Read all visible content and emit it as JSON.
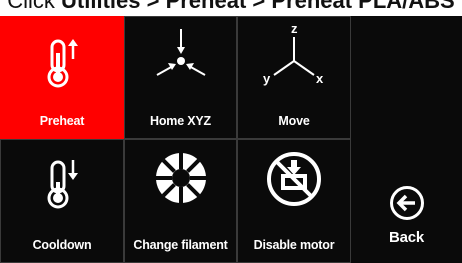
{
  "instruction": {
    "prefix": "Click ",
    "path": "Utilities > Preheat > Preheat PLA/ABS"
  },
  "menu": {
    "tiles": [
      {
        "label": "Preheat",
        "icon": "thermometer-up-icon",
        "active": true
      },
      {
        "label": "Home XYZ",
        "icon": "home-xyz-icon"
      },
      {
        "label": "Move",
        "icon": "axes-icon"
      },
      {
        "label": "Cooldown",
        "icon": "thermometer-down-icon"
      },
      {
        "label": "Change filament",
        "icon": "filament-spool-icon"
      },
      {
        "label": "Disable motor",
        "icon": "disable-motor-icon"
      }
    ],
    "back": {
      "label": "Back",
      "icon": "back-arrow-icon"
    }
  },
  "colors": {
    "active": "#ff0000",
    "background": "#0a0a0a",
    "foreground": "#ffffff"
  }
}
